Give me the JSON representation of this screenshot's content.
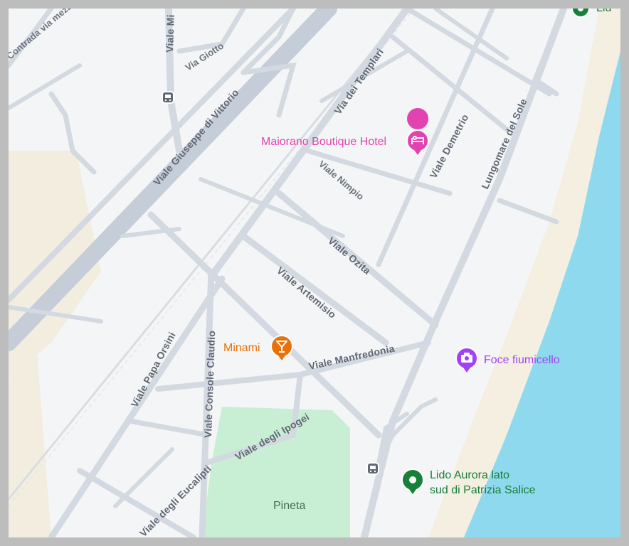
{
  "map": {
    "streets": {
      "viale_giuseppe_di_vittorio": "Viale Giuseppe di Vittorio",
      "via_dei_templari": "Via dei Templari",
      "viale_demetrio": "Viale Demetrio",
      "lungomare_del_sole": "Lungomare del Sole",
      "viale_nimpio": "Viale Nimpio",
      "viale_ozita": "Viale Ozita",
      "viale_artemisio": "Viale Artemisio",
      "viale_manfredonia": "Viale Manfredonia",
      "viale_papa_orsini": "Viale Papa Orsini",
      "viale_console_claudio": "Viale Console Claudio",
      "viale_degli_ipogei": "Viale degli Ipogei",
      "viale_degli_eucalipti": "Viale degli Eucalipti",
      "via_giotto": "Via Giotto",
      "viale_mi": "Viale Mi",
      "contrada_via_mezz": "Contrada via mezz"
    },
    "areas": {
      "pineta": "Pineta"
    },
    "places": {
      "hotel": "Maiorano Boutique Hotel",
      "bar": "Minami",
      "photo_spot": "Foce fiumicello",
      "beach_line1": "Lido Aurora lato",
      "beach_line2": "sud di Patrizia Salice",
      "top_right_partial": "Lid"
    },
    "colors": {
      "land": "#f4f5f6",
      "road": "#d3d9e1",
      "road_main": "#c5cdd8",
      "sea": "#8fd9ef",
      "sand": "#f5efe1",
      "park": "#c8efd4",
      "hotel": "#e243b1",
      "bar": "#e8710a",
      "photo": "#a142f4",
      "beach": "#188038"
    },
    "icons": {
      "hotel": "bed-icon",
      "bar": "cocktail-icon",
      "photo": "camera-icon",
      "beach": "beach-pin-icon",
      "bus_stop": "bus-icon"
    }
  }
}
